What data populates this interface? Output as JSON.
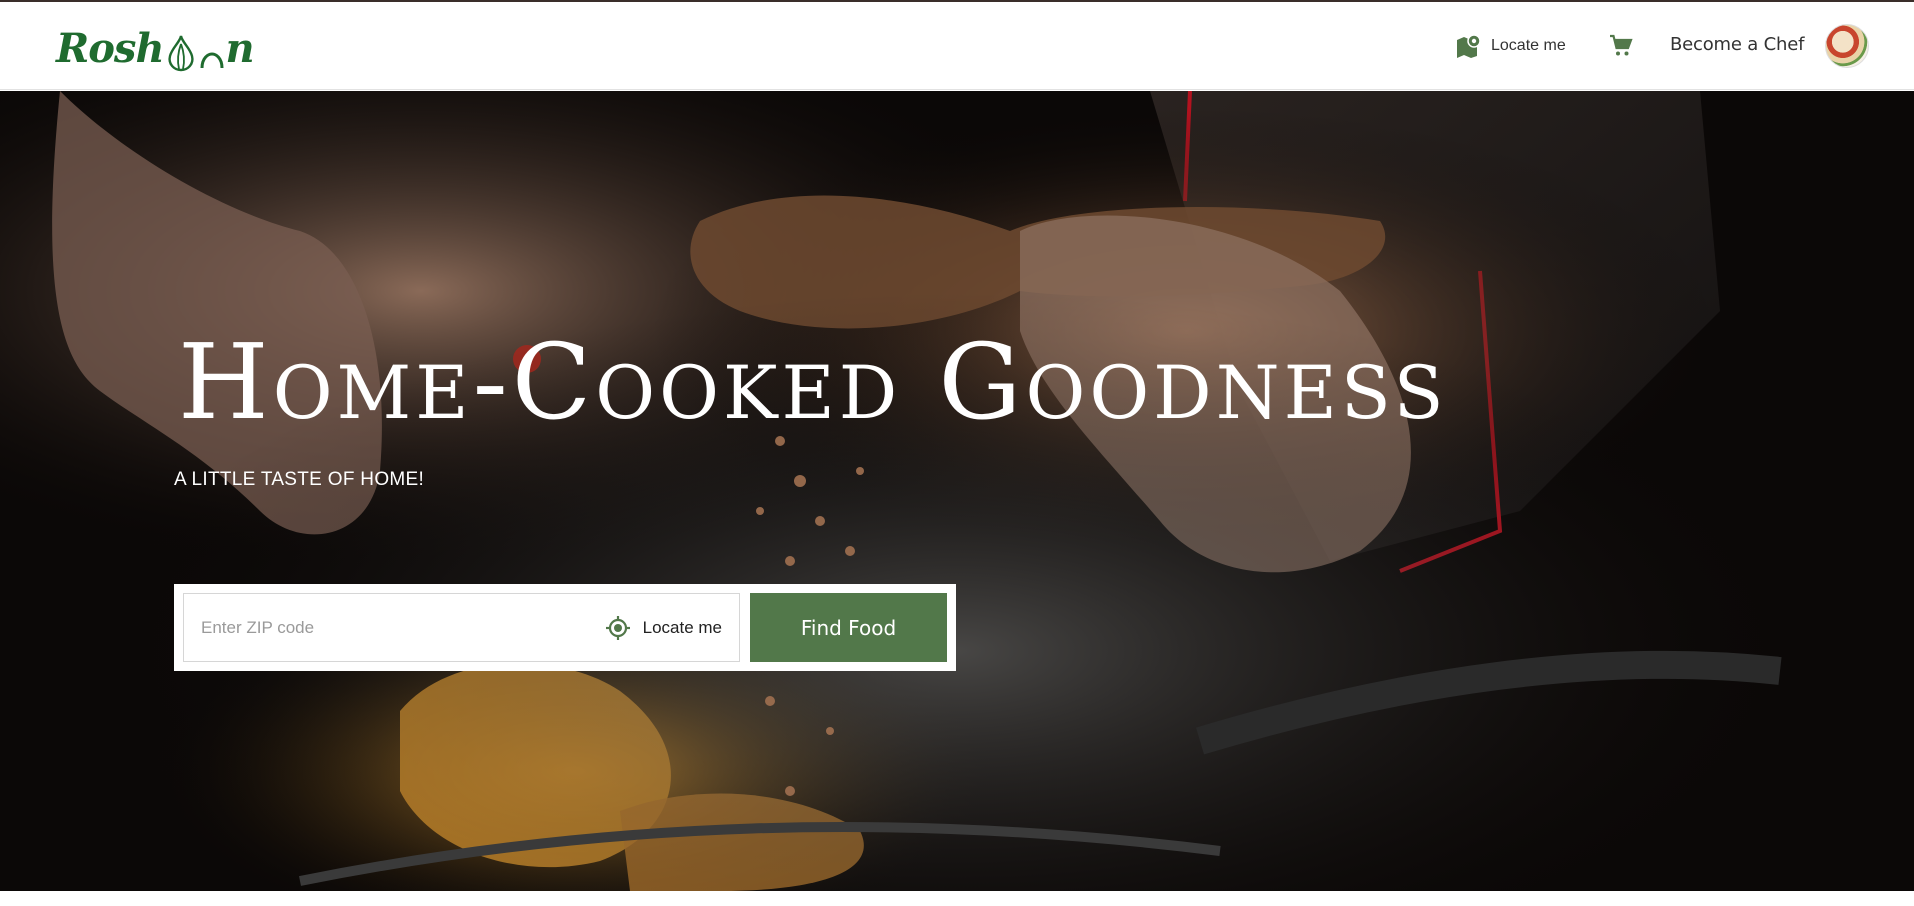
{
  "header": {
    "logo_text_start": "Rosh",
    "logo_text_end": "n",
    "nav_locate_label": "Locate me",
    "become_chef_label": "Become a Chef"
  },
  "hero": {
    "title": "Home-Cooked Goodness",
    "subtitle": "A LITTLE TASTE OF HOME!",
    "zip_placeholder": "Enter ZIP code",
    "zip_value": "",
    "locate_label": "Locate me",
    "find_button_label": "Find Food"
  },
  "colors": {
    "brand_green": "#1f6b2f",
    "button_green": "#52784a",
    "hero_background": "#0b0807"
  },
  "icons": {
    "nav_locate": "map-pin-icon",
    "cart": "shopping-cart-icon",
    "locate": "crosshair-target-icon"
  }
}
